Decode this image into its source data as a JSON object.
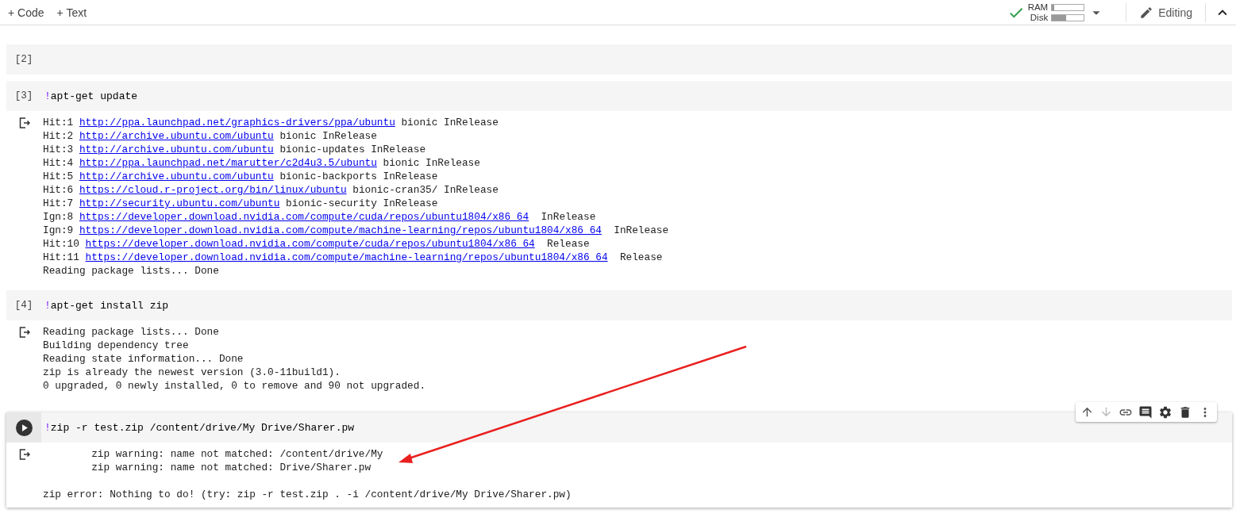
{
  "toolbar": {
    "add_buttons": [
      {
        "symbol": "+",
        "label": "Code"
      },
      {
        "symbol": "+",
        "label": "Text"
      }
    ],
    "resources": {
      "connected": true,
      "meters": [
        {
          "label": "RAM",
          "level": 0.08
        },
        {
          "label": "Disk",
          "level": 0.45
        }
      ]
    },
    "mode": "Editing"
  },
  "cells": [
    {
      "kind": "executed",
      "number": "[2]"
    },
    {
      "kind": "executed",
      "number": "[3]",
      "magic": "!",
      "code": "apt-get update",
      "output": [
        {
          "prefix": "Hit:1 ",
          "url": "http://ppa.launchpad.net/graphics-drivers/ppa/ubuntu",
          "suffix": " bionic InRelease"
        },
        {
          "prefix": "Hit:2 ",
          "url": "http://archive.ubuntu.com/ubuntu",
          "suffix": " bionic InRelease"
        },
        {
          "prefix": "Hit:3 ",
          "url": "http://archive.ubuntu.com/ubuntu",
          "suffix": " bionic-updates InRelease"
        },
        {
          "prefix": "Hit:4 ",
          "url": "http://ppa.launchpad.net/marutter/c2d4u3.5/ubuntu",
          "suffix": " bionic InRelease"
        },
        {
          "prefix": "Hit:5 ",
          "url": "http://archive.ubuntu.com/ubuntu",
          "suffix": " bionic-backports InRelease"
        },
        {
          "prefix": "Hit:6 ",
          "url": "https://cloud.r-project.org/bin/linux/ubuntu",
          "suffix": " bionic-cran35/ InRelease"
        },
        {
          "prefix": "Hit:7 ",
          "url": "http://security.ubuntu.com/ubuntu",
          "suffix": " bionic-security InRelease"
        },
        {
          "prefix": "Ign:8 ",
          "url": "https://developer.download.nvidia.com/compute/cuda/repos/ubuntu1804/x86_64",
          "suffix": "  InRelease"
        },
        {
          "prefix": "Ign:9 ",
          "url": "https://developer.download.nvidia.com/compute/machine-learning/repos/ubuntu1804/x86_64",
          "suffix": "  InRelease"
        },
        {
          "prefix": "Hit:10 ",
          "url": "https://developer.download.nvidia.com/compute/cuda/repos/ubuntu1804/x86_64",
          "suffix": "  Release"
        },
        {
          "prefix": "Hit:11 ",
          "url": "https://developer.download.nvidia.com/compute/machine-learning/repos/ubuntu1804/x86_64",
          "suffix": "  Release"
        },
        {
          "prefix": "Reading package lists... Done"
        }
      ]
    },
    {
      "kind": "executed",
      "number": "[4]",
      "magic": "!",
      "code": "apt-get install zip",
      "output": [
        {
          "prefix": "Reading package lists... Done"
        },
        {
          "prefix": "Building dependency tree"
        },
        {
          "prefix": "Reading state information... Done"
        },
        {
          "prefix": "zip is already the newest version (3.0-11build1)."
        },
        {
          "prefix": "0 upgraded, 0 newly installed, 0 to remove and 90 not upgraded."
        }
      ]
    },
    {
      "kind": "active",
      "magic": "!",
      "code": "zip -r test.zip /content/drive/My Drive/Sharer.pw",
      "output": [
        {
          "kind": "text",
          "prefix": "        zip warning: name not matched: /content/drive/My"
        },
        {
          "kind": "text",
          "prefix": "        zip warning: name not matched: Drive/Sharer.pw"
        },
        {
          "kind": "blank"
        },
        {
          "kind": "text",
          "prefix": "zip error: Nothing to do! (try: zip -r test.zip . -i /content/drive/My Drive/Sharer.pw)"
        }
      ]
    }
  ]
}
